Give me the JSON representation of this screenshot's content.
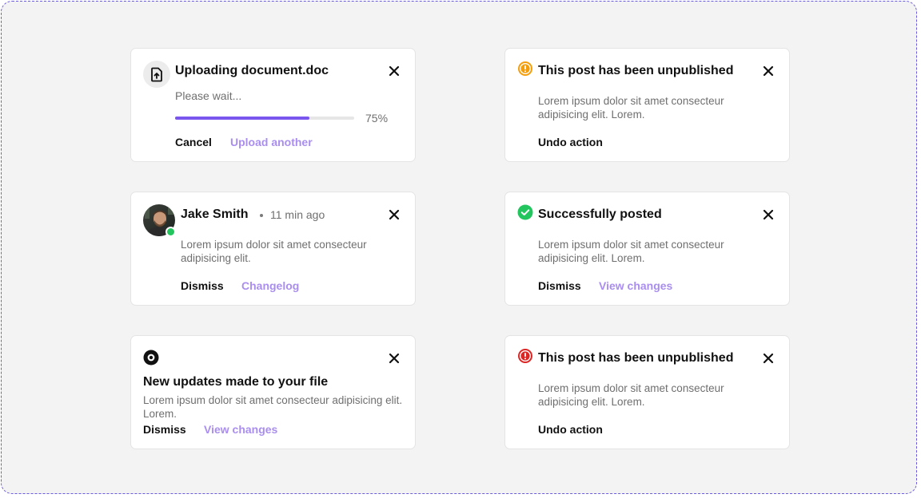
{
  "colors": {
    "accent": "#7a55ee",
    "link_purple": "#a98ef0",
    "warning_orange": "#f59e0b",
    "success_green": "#22c55e",
    "error_red": "#dc2626",
    "frame_border": "#6b5ce0"
  },
  "upload": {
    "icon": "file-upload-icon",
    "title": "Uploading document.doc",
    "subtitle": "Please wait...",
    "progress": 0.75,
    "progress_label": "75%",
    "cancel_label": "Cancel",
    "secondary_label": "Upload another"
  },
  "unpublished_warning": {
    "icon": "warning-circle-icon",
    "title": "This post has been unpublished",
    "body": "Lorem ipsum dolor sit amet consecteur adipisicing elit. Lorem.",
    "action_label": "Undo action"
  },
  "user_message": {
    "name": "Jake Smith",
    "time": "11 min ago",
    "body": "Lorem ipsum dolor sit amet consecteur adipisicing elit.",
    "dismiss_label": "Dismiss",
    "secondary_label": "Changelog"
  },
  "success": {
    "icon": "check-circle-icon",
    "title": "Successfully posted",
    "body": "Lorem ipsum dolor sit amet consecteur adipisicing elit. Lorem.",
    "dismiss_label": "Dismiss",
    "secondary_label": "View changes"
  },
  "file_update": {
    "icon": "record-circle-icon",
    "title": "New updates made to your file",
    "body": "Lorem ipsum dolor sit amet consecteur adipisicing elit. Lorem.",
    "dismiss_label": "Dismiss",
    "secondary_label": "View changes"
  },
  "unpublished_error": {
    "icon": "error-circle-icon",
    "title": "This post has been unpublished",
    "body": "Lorem ipsum dolor sit amet consecteur adipisicing elit. Lorem.",
    "action_label": "Undo action"
  }
}
